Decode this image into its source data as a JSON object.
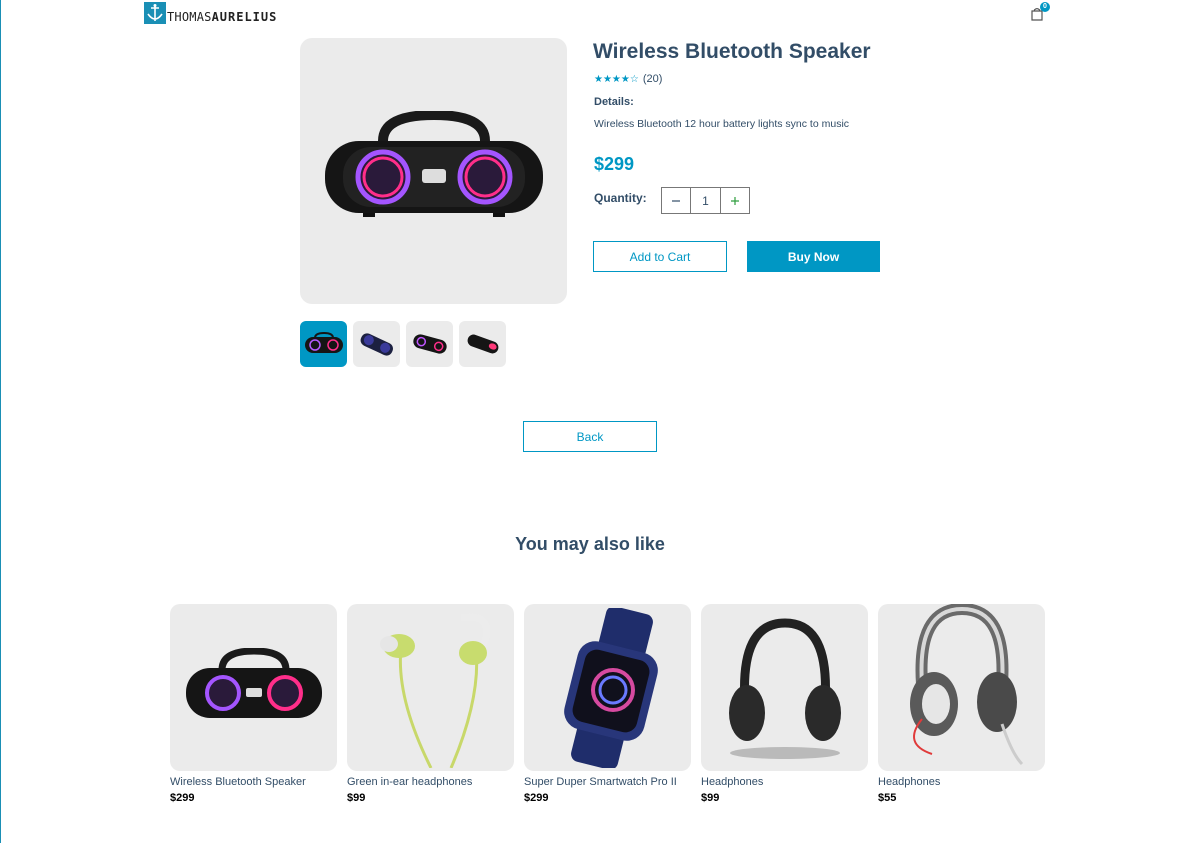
{
  "navbar": {
    "logo_part1": "THOMAS",
    "logo_part2": "AURELIUS",
    "cart_count": "0"
  },
  "product": {
    "title": "Wireless Bluetooth Speaker",
    "rating_stars": 4,
    "review_count": "(20)",
    "details_heading": "Details:",
    "details_text": "Wireless Bluetooth 12 hour battery lights sync to music",
    "price": "$299",
    "quantity_label": "Quantity:",
    "quantity": "1",
    "add_to_cart": "Add to Cart",
    "buy_now": "Buy Now",
    "selected_thumb": 0
  },
  "back_label": "Back",
  "recommendations": {
    "heading": "You may also like",
    "items": [
      {
        "name": "Wireless Bluetooth Speaker",
        "price": "$299"
      },
      {
        "name": "Green in-ear headphones",
        "price": "$99"
      },
      {
        "name": "Super Duper Smartwatch Pro II",
        "price": "$299"
      },
      {
        "name": "Headphones",
        "price": "$99"
      },
      {
        "name": "Headphones",
        "price": "$55"
      }
    ]
  },
  "colors": {
    "accent": "#0097c4",
    "text": "#324d67",
    "image_bg": "#ebebeb"
  }
}
